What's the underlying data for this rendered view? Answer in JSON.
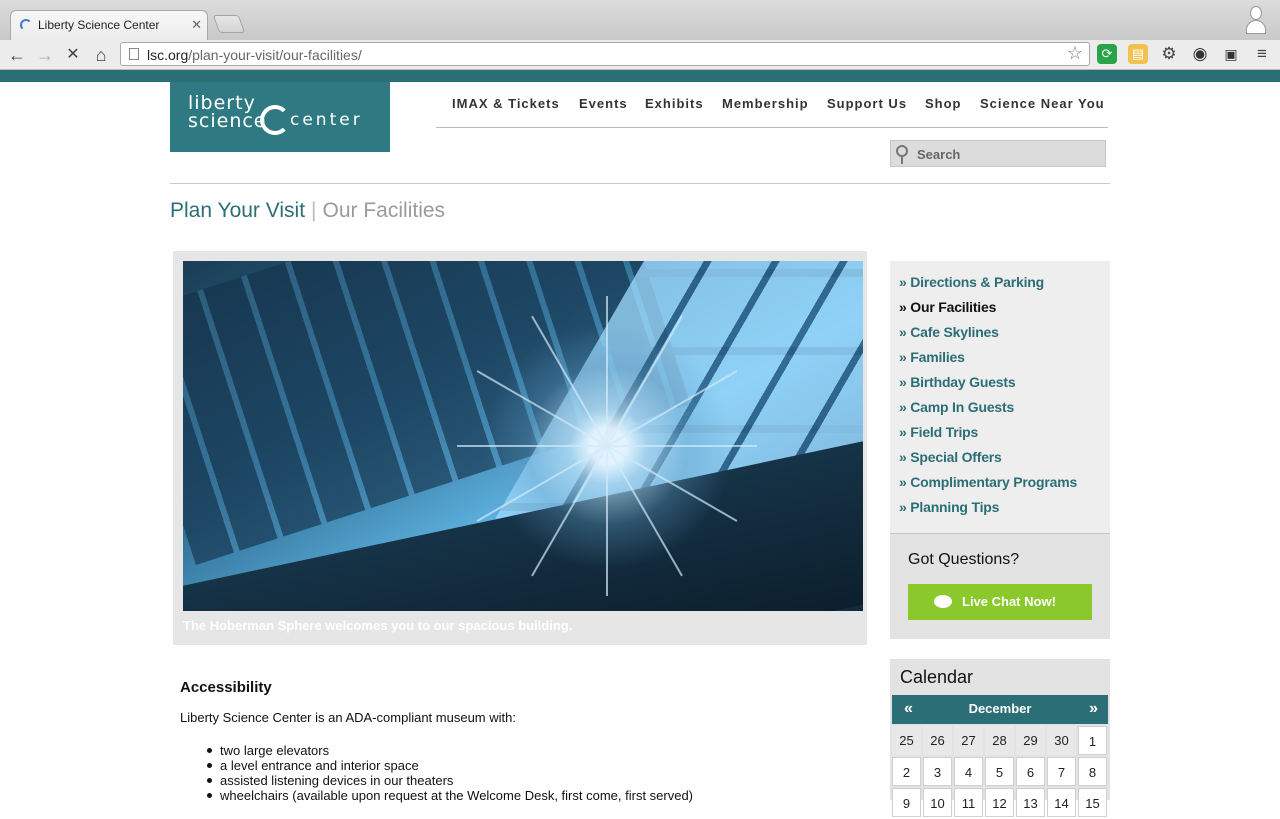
{
  "browser": {
    "tab_title": "Liberty Science Center",
    "url_domain": "lsc.org",
    "url_path": "/plan-your-visit/our-facilities/",
    "icons": [
      "back-icon",
      "forward-icon",
      "stop-icon",
      "home-icon",
      "bookmark-star-icon",
      "menu-icon"
    ]
  },
  "site": {
    "logo": {
      "line1": "liberty",
      "line2": "science",
      "line3": "center"
    },
    "nav": [
      "IMAX & Tickets",
      "Events",
      "Exhibits",
      "Membership",
      "Support Us",
      "Shop",
      "Science Near You"
    ],
    "search_placeholder": "Search",
    "colors": {
      "teal": "#2c6e76",
      "green": "#8bc82b"
    }
  },
  "breadcrumb": {
    "parent": "Plan Your Visit",
    "current": "Our Facilities",
    "separator": "|"
  },
  "hero": {
    "caption": "The Hoberman Sphere welcomes you to our spacious building."
  },
  "accessibility": {
    "heading": "Accessibility",
    "intro": "Liberty Science Center is an ADA-compliant museum with:",
    "items": [
      "two large elevators",
      "a level entrance and interior space",
      "assisted listening devices in our theaters",
      "wheelchairs (available upon request at the Welcome Desk, first come, first served)"
    ]
  },
  "sidenav": {
    "items": [
      {
        "label": "» Directions & Parking",
        "active": false
      },
      {
        "label": "» Our Facilities",
        "active": true
      },
      {
        "label": "» Cafe Skylines",
        "active": false
      },
      {
        "label": "» Families",
        "active": false
      },
      {
        "label": "» Birthday Guests",
        "active": false
      },
      {
        "label": "» Camp In Guests",
        "active": false
      },
      {
        "label": "» Field Trips",
        "active": false
      },
      {
        "label": "» Special Offers",
        "active": false
      },
      {
        "label": "» Complimentary Programs",
        "active": false
      },
      {
        "label": "» Planning Tips",
        "active": false
      }
    ]
  },
  "questions": {
    "title": "Got Questions?",
    "chat_label": "Live Chat Now!"
  },
  "calendar": {
    "title": "Calendar",
    "month": "December",
    "prev": "«",
    "next": "»",
    "weeks": [
      [
        "25",
        "26",
        "27",
        "28",
        "29",
        "30",
        "1"
      ],
      [
        "2",
        "3",
        "4",
        "5",
        "6",
        "7",
        "8"
      ],
      [
        "9",
        "10",
        "11",
        "12",
        "13",
        "14",
        "15"
      ]
    ],
    "current_month_days_start_index": 6
  }
}
